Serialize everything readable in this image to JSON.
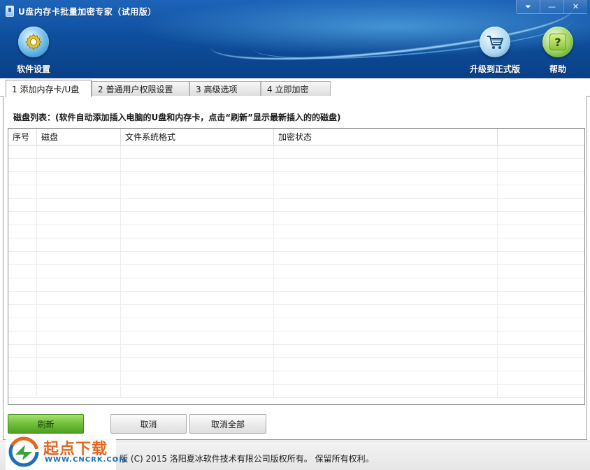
{
  "window": {
    "title": "U盘内存卡批量加密专家（试用版）",
    "controls": {
      "menu": "⏷",
      "minimize": "—",
      "close": "✕"
    }
  },
  "toolbar": {
    "settings_label": "软件设置",
    "upgrade_label": "升级到正式版",
    "help_label": "帮助",
    "help_glyph": "?"
  },
  "tabs": [
    {
      "label": "1 添加内存卡/U盘",
      "active": true
    },
    {
      "label": "2 普通用户权限设置",
      "active": false
    },
    {
      "label": "3 高级选项",
      "active": false
    },
    {
      "label": "4 立即加密",
      "active": false
    }
  ],
  "disk_list": {
    "label": "磁盘列表：(软件自动添加插入电脑的U盘和内存卡，点击“刷新”显示最新插入的的磁盘)",
    "columns": [
      "序号",
      "磁盘",
      "文件系统格式",
      "加密状态",
      ""
    ],
    "rows": []
  },
  "buttons": {
    "refresh": "刷新",
    "cancel": "取消",
    "cancel_all": "取消全部"
  },
  "status": {
    "text": "00 版 (C) 2015 洛阳夏冰软件技术有限公司版权所有。 保留所有权利。"
  },
  "watermark": {
    "title": "起点下载",
    "sub": "WWW.CNCRK.COM"
  },
  "icons": {
    "settings": "gear-icon",
    "upgrade": "shopping-cart-icon",
    "help": "help-icon",
    "app": "usb-drive-icon"
  },
  "colors": {
    "header_blue": "#0f4f9e",
    "primary_green": "#6fc03a",
    "watermark_orange": "#e6671f",
    "watermark_blue": "#1f6fb7"
  }
}
